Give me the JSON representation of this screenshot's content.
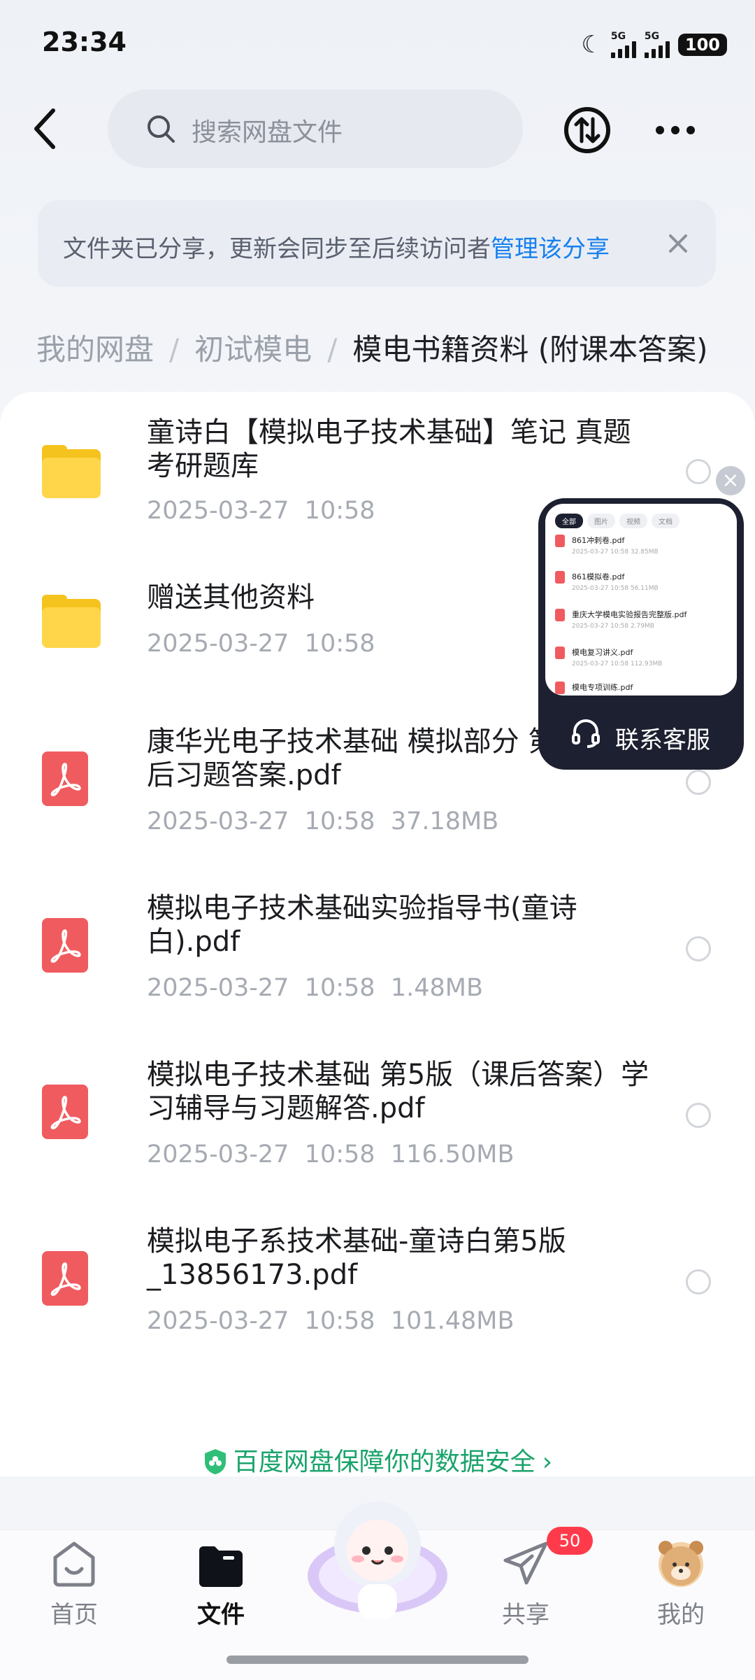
{
  "status": {
    "time": "23:34",
    "net1": "5G",
    "net2": "5G",
    "battery": "100"
  },
  "search": {
    "placeholder": "搜索网盘文件"
  },
  "tip": {
    "text": "文件夹已分享，更新会同步至后续访问者",
    "link": "管理该分享"
  },
  "breadcrumb": {
    "root": "我的网盘",
    "parent": "初试模电",
    "current": "模电书籍资料 (附课本答案)"
  },
  "files": [
    {
      "type": "folder",
      "name": "童诗白【模拟电子技术基础】笔记 真题考研题库",
      "date": "2025-03-27",
      "time": "10:58",
      "size": ""
    },
    {
      "type": "folder",
      "name": "赠送其他资料",
      "date": "2025-03-27",
      "time": "10:58",
      "size": ""
    },
    {
      "type": "pdf",
      "name": "康华光电子技术基础 模拟部分 第六版课后习题答案.pdf",
      "date": "2025-03-27",
      "time": "10:58",
      "size": "37.18MB"
    },
    {
      "type": "pdf",
      "name": "模拟电子技术基础实验指导书(童诗白).pdf",
      "date": "2025-03-27",
      "time": "10:58",
      "size": "1.48MB"
    },
    {
      "type": "pdf",
      "name": "模拟电子技术基础  第5版（课后答案）学习辅导与习题解答.pdf",
      "date": "2025-03-27",
      "time": "10:58",
      "size": "116.50MB"
    },
    {
      "type": "pdf",
      "name": "模拟电子系技术基础-童诗白第5版_13856173.pdf",
      "date": "2025-03-27",
      "time": "10:58",
      "size": "101.48MB"
    }
  ],
  "floating": {
    "label": "联系客服",
    "tabs": [
      "全部",
      "图片",
      "视频",
      "文档"
    ],
    "items": [
      {
        "name": "861冲刺卷.pdf",
        "meta": "2025-03-27 10:58 32.85MB"
      },
      {
        "name": "861模拟卷.pdf",
        "meta": "2025-03-27 10:58 56.11MB"
      },
      {
        "name": "重庆大学模电实验报告完整版.pdf",
        "meta": "2025-03-27 10:58 2.79MB"
      },
      {
        "name": "模电复习讲义.pdf",
        "meta": "2025-03-27 10:58 112.93MB"
      },
      {
        "name": "模电专项训练.pdf",
        "meta": ""
      }
    ]
  },
  "safety": {
    "text": "百度网盘保障你的数据安全"
  },
  "tabbar": {
    "home": "首页",
    "files": "文件",
    "share": "共享",
    "mine": "我的",
    "share_badge": "50"
  }
}
